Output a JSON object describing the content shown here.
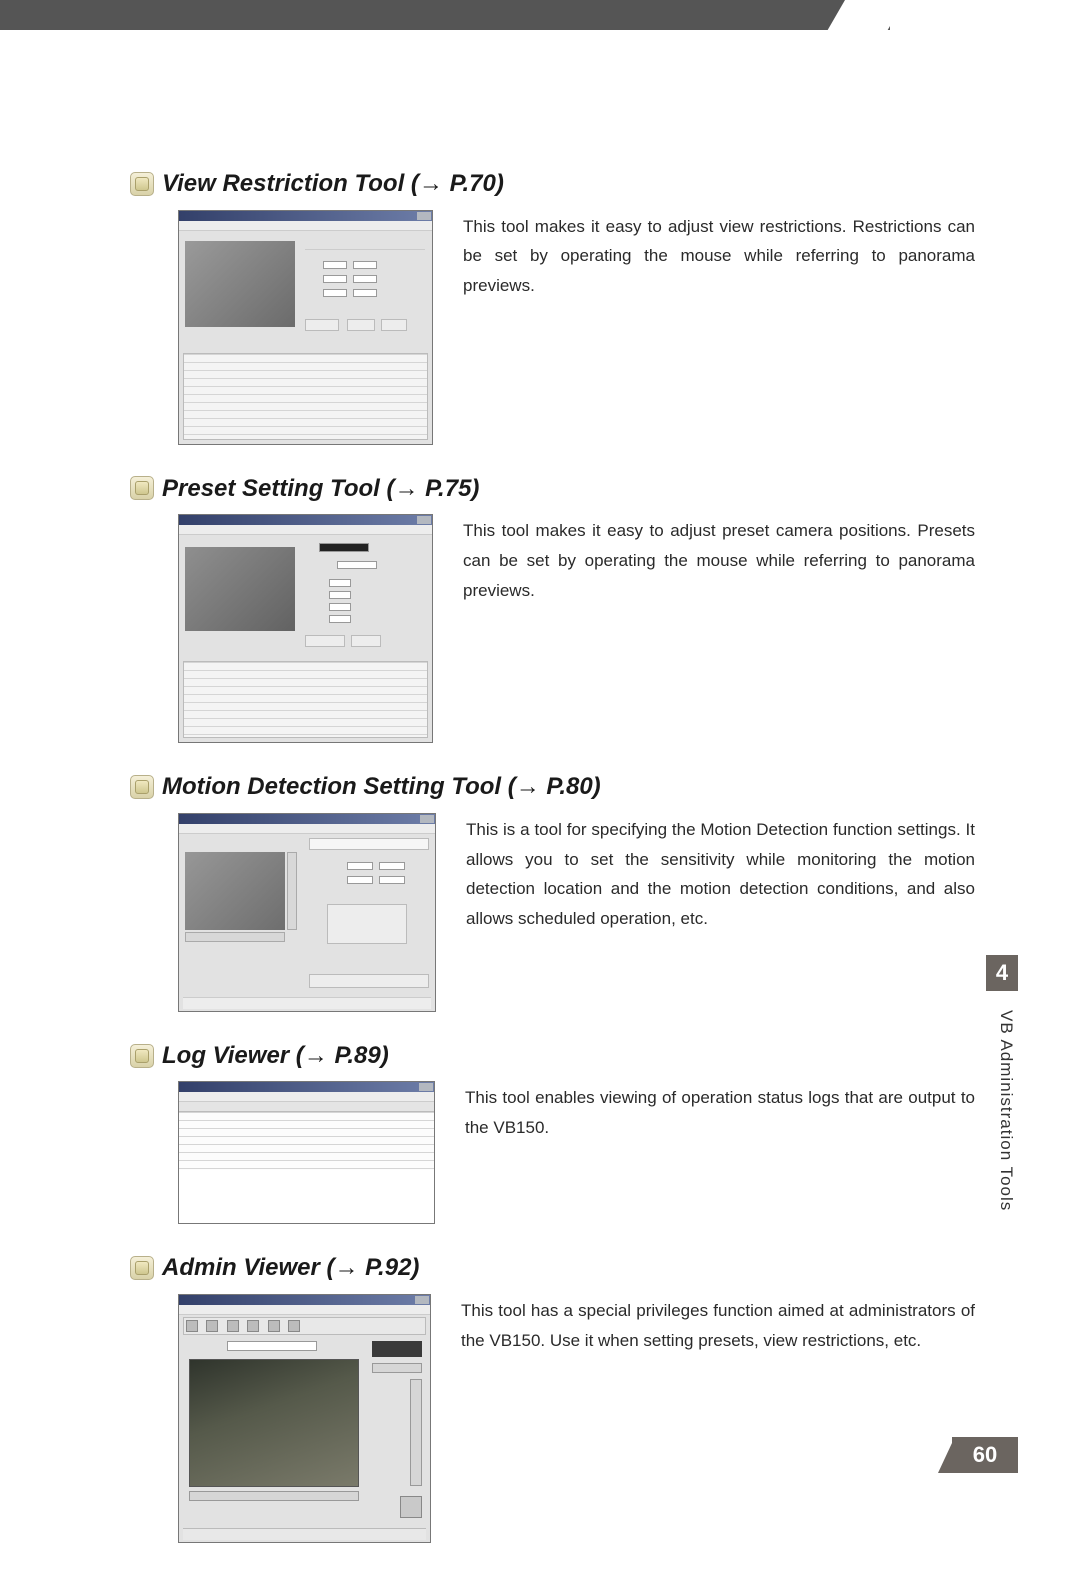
{
  "chapter_tab": "4",
  "side_label": "VB Administration Tools",
  "page_number": "60",
  "sections": [
    {
      "key": "view_restriction",
      "heading": "View Restriction Tool (→ P.70)",
      "description": "This tool makes it easy to adjust view restrictions. Restrictions can be set by operating the mouse while referring to panorama previews."
    },
    {
      "key": "preset_setting",
      "heading": "Preset Setting Tool (→ P.75)",
      "description": "This tool makes it easy to adjust preset camera positions. Presets can be set by operating the mouse while referring to panorama previews."
    },
    {
      "key": "motion_detection",
      "heading": "Motion Detection Setting Tool (→ P.80)",
      "description": "This is a tool for specifying the Motion Detection function settings. It allows you to set the sensitivity while monitoring the motion detection location and the motion detection conditions, and also allows scheduled operation, etc."
    },
    {
      "key": "log_viewer",
      "heading": "Log Viewer (→ P.89)",
      "description": "This tool enables viewing of operation status logs that are output to the VB150."
    },
    {
      "key": "admin_viewer",
      "heading": "Admin Viewer (→ P.92)",
      "description": "This tool has a special privileges function aimed at administrators of the VB150. Use it when setting presets, view restrictions, etc."
    }
  ]
}
